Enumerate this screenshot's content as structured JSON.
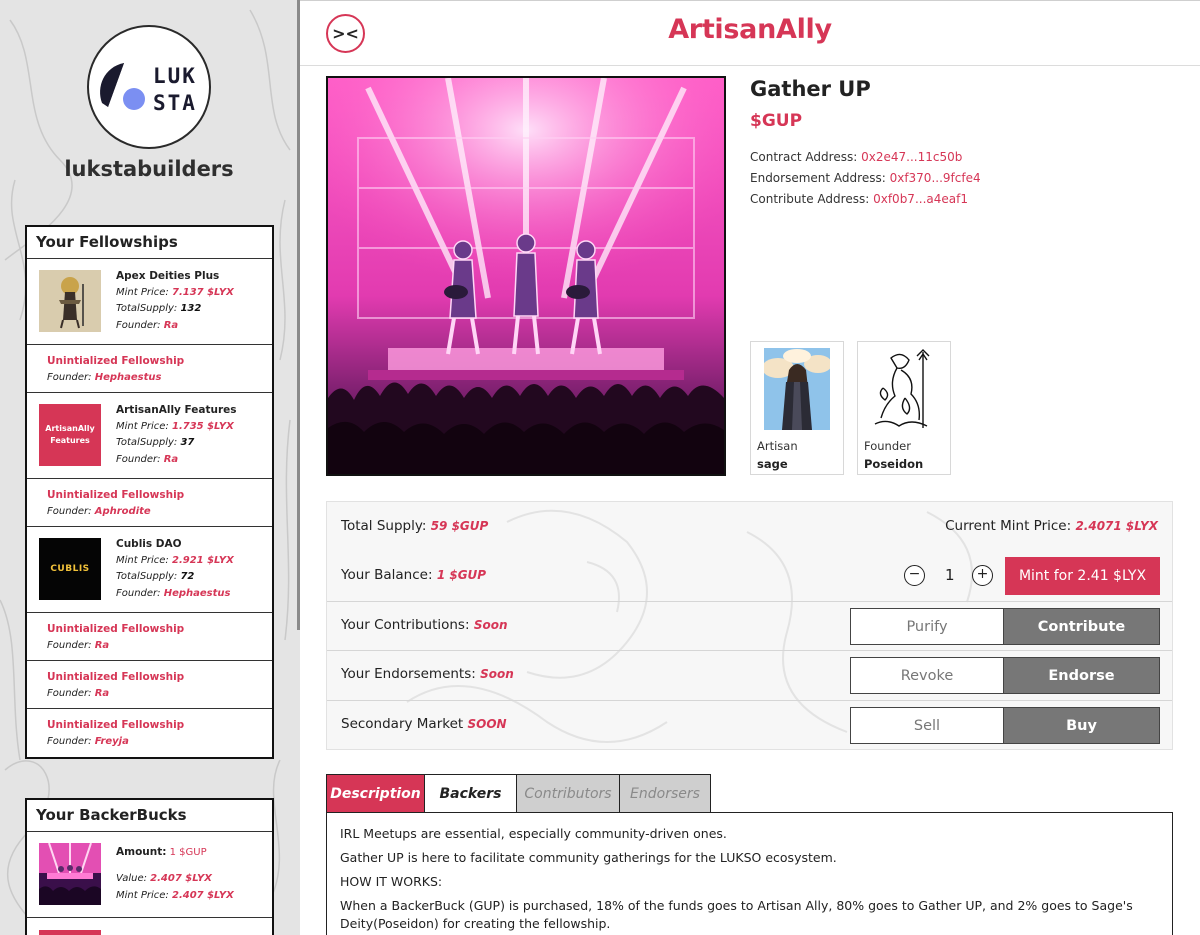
{
  "sidebar": {
    "org_name": "lukstabuilders",
    "logo_line1": "LUK",
    "logo_line2": "STA",
    "fellowships_title": "Your Fellowships",
    "fellowships": [
      {
        "name": "Apex Deities Plus",
        "mint_price_label": "Mint Price:",
        "mint_price": "7.137 $LYX",
        "supply_label": "TotalSupply:",
        "supply": "132",
        "founder_label": "Founder:",
        "founder": "Ra"
      },
      {
        "title": "Unintialized Fellowship",
        "founder_label": "Founder:",
        "founder": "Hephaestus"
      },
      {
        "name": "ArtisanAlly Features",
        "thumb_text": "ArtisanAlly Features",
        "mint_price_label": "Mint Price:",
        "mint_price": "1.735 $LYX",
        "supply_label": "TotalSupply:",
        "supply": "37",
        "founder_label": "Founder:",
        "founder": "Ra"
      },
      {
        "title": "Unintialized Fellowship",
        "founder_label": "Founder:",
        "founder": "Aphrodite"
      },
      {
        "name": "Cublis DAO",
        "thumb_text": "CUBLIS",
        "mint_price_label": "Mint Price:",
        "mint_price": "2.921 $LYX",
        "supply_label": "TotalSupply:",
        "supply": "72",
        "founder_label": "Founder:",
        "founder": "Hephaestus"
      },
      {
        "title": "Unintialized Fellowship",
        "founder_label": "Founder:",
        "founder": "Ra"
      },
      {
        "title": "Unintialized Fellowship",
        "founder_label": "Founder:",
        "founder": "Ra"
      },
      {
        "title": "Unintialized Fellowship",
        "founder_label": "Founder:",
        "founder": "Freyja"
      }
    ],
    "backerbucks_title": "Your BackerBucks",
    "backerbucks": [
      {
        "amount_label": "Amount:",
        "amount": "1 $GUP",
        "value_label": "Value:",
        "value": "2.407 $LYX",
        "mint_price_label": "Mint Price:",
        "mint_price": "2.407 $LYX"
      }
    ]
  },
  "header": {
    "app_title": "ArtisanAlly",
    "collapse_icon": "><"
  },
  "token": {
    "name": "Gather UP",
    "symbol": "$GUP",
    "contract_label": "Contract Address:",
    "contract": "0x2e47...11c50b",
    "endorsement_label": "Endorsement Address:",
    "endorsement": "0xf370...9fcfe4",
    "contribute_label": "Contribute Address:",
    "contribute": "0xf0b7...a4eaf1"
  },
  "people": [
    {
      "role": "Artisan",
      "name": "sage"
    },
    {
      "role": "Founder",
      "name": "Poseidon"
    }
  ],
  "stats": {
    "total_supply_label": "Total Supply:",
    "total_supply": "59 $GUP",
    "mint_price_label": "Current Mint Price:",
    "mint_price": "2.4071 $LYX",
    "balance_label": "Your Balance:",
    "balance": "1 $GUP",
    "quantity": "1",
    "minus": "−",
    "plus": "+",
    "mint_button": "Mint for 2.41 $LYX",
    "contributions_label": "Your Contributions:",
    "contributions": "Soon",
    "purify_button": "Purify",
    "contribute_button": "Contribute",
    "endorsements_label": "Your Endorsements:",
    "endorsements": "Soon",
    "revoke_button": "Revoke",
    "endorse_button": "Endorse",
    "market_label": "Secondary Market",
    "market": "SOON",
    "sell_button": "Sell",
    "buy_button": "Buy"
  },
  "tabs": [
    "Description",
    "Backers",
    "Contributors",
    "Endorsers"
  ],
  "description": [
    "IRL Meetups are essential, especially community-driven ones.",
    "Gather UP is here to facilitate community gatherings for the LUKSO ecosystem.",
    "HOW IT WORKS:",
    "When a BackerBuck (GUP) is purchased, 18% of the funds goes to Artisan Ally, 80% goes to Gather UP, and 2% goes to Sage's Deity(Poseidon) for creating the fellowship."
  ],
  "colors": {
    "accent": "#d63656",
    "button_dark": "#777777",
    "sidebar_bg": "#e4e4e4"
  }
}
